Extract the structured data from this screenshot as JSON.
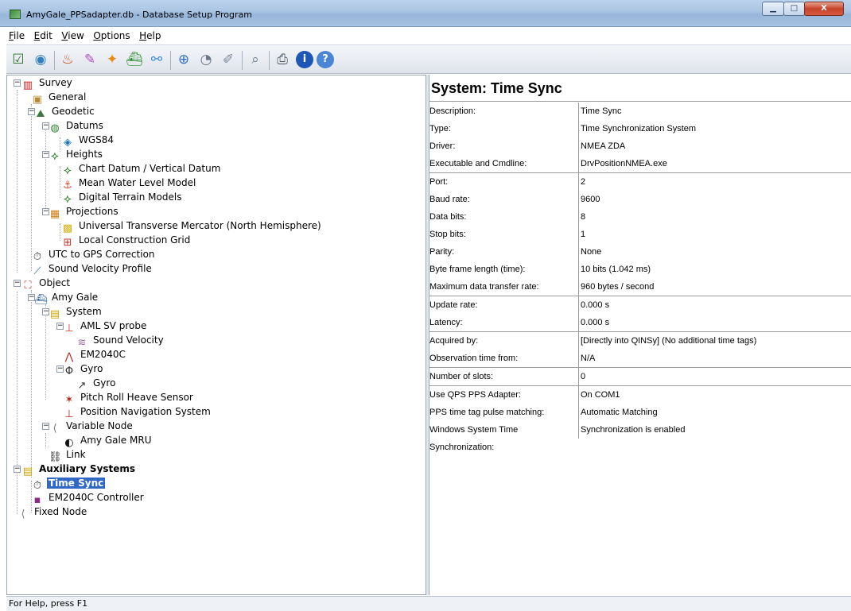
{
  "window": {
    "title": "AmyGale_PPSadapter.db - Database Setup Program",
    "controls": {
      "minimize": "▁",
      "maximize": "□",
      "close": "X"
    }
  },
  "menu": [
    "File",
    "Edit",
    "View",
    "Options",
    "Help"
  ],
  "toolbar": {
    "icons": [
      "new-database-icon",
      "globe-icon",
      "object-icon",
      "wand-icon",
      "add-node-icon",
      "vessel-icon",
      "link-icon",
      "web-icon",
      "pie-icon",
      "pen-icon",
      "preview-icon",
      "print-icon",
      "info-icon",
      "help-icon"
    ]
  },
  "tree": [
    {
      "label": "Survey",
      "icon": "survey-icon"
    },
    {
      "label": "General",
      "icon": "general-icon"
    },
    {
      "label": "Geodetic",
      "icon": "geodetic-icon"
    },
    {
      "label": "Datums",
      "icon": "datum-icon"
    },
    {
      "label": "WGS84",
      "icon": "wgs84-icon"
    },
    {
      "label": "Heights",
      "icon": "heights-icon"
    },
    {
      "label": "Chart Datum / Vertical Datum",
      "icon": "heights-icon"
    },
    {
      "label": "Mean Water Level Model",
      "icon": "water-level-icon"
    },
    {
      "label": "Digital Terrain Models",
      "icon": "heights-icon"
    },
    {
      "label": "Projections",
      "icon": "projection-icon"
    },
    {
      "label": "Universal Transverse Mercator (North Hemisphere)",
      "icon": "utm-icon"
    },
    {
      "label": "Local Construction Grid",
      "icon": "grid-icon"
    },
    {
      "label": "UTC to GPS Correction",
      "icon": "clock-icon"
    },
    {
      "label": "Sound Velocity Profile",
      "icon": "profile-icon"
    },
    {
      "label": "Object",
      "icon": "object-icon"
    },
    {
      "label": "Amy Gale",
      "icon": "vessel-icon"
    },
    {
      "label": "System",
      "icon": "system-icon"
    },
    {
      "label": "AML SV probe",
      "icon": "probe-icon"
    },
    {
      "label": "Sound Velocity",
      "icon": "sound-velocity-icon"
    },
    {
      "label": "EM2040C",
      "icon": "multibeam-icon"
    },
    {
      "label": "Gyro",
      "icon": "gyro-icon"
    },
    {
      "label": "Gyro",
      "icon": "gyro-arrow-icon"
    },
    {
      "label": "Pitch Roll Heave Sensor",
      "icon": "motion-sensor-icon"
    },
    {
      "label": "Position Navigation System",
      "icon": "antenna-icon"
    },
    {
      "label": "Variable Node",
      "icon": "node-icon"
    },
    {
      "label": "Amy Gale MRU",
      "icon": "mru-icon"
    },
    {
      "label": "Link",
      "icon": "link-icon"
    },
    {
      "label": "Auxiliary Systems",
      "icon": "system-icon"
    },
    {
      "label": "Time Sync",
      "icon": "clock-icon"
    },
    {
      "label": "EM2040C Controller",
      "icon": "controller-icon"
    },
    {
      "label": "Fixed Node",
      "icon": "node-icon"
    }
  ],
  "detail": {
    "title": "System: Time Sync",
    "rows": [
      {
        "k": "Description:",
        "v": "Time Sync"
      },
      {
        "k": "Type:",
        "v": "Time Synchronization System"
      },
      {
        "k": "Driver:",
        "v": "NMEA ZDA"
      },
      {
        "k": "Executable and Cmdline:",
        "v": "DrvPositionNMEA.exe"
      },
      {
        "k": "Port:",
        "v": "2"
      },
      {
        "k": "Baud rate:",
        "v": "9600"
      },
      {
        "k": "Data bits:",
        "v": "8"
      },
      {
        "k": "Stop bits:",
        "v": "1"
      },
      {
        "k": "Parity:",
        "v": "None"
      },
      {
        "k": "Byte frame length (time):",
        "v": "10 bits (1.042 ms)"
      },
      {
        "k": "Maximum data transfer rate:",
        "v": "960 bytes / second"
      },
      {
        "k": "Update rate:",
        "v": "0.000 s"
      },
      {
        "k": "Latency:",
        "v": "0.000 s"
      },
      {
        "k": "Acquired by:",
        "v": "[Directly into QINSy] (No additional time tags)"
      },
      {
        "k": "Observation time from:",
        "v": "N/A"
      },
      {
        "k": "Number of slots:",
        "v": "0"
      },
      {
        "k": "Use QPS PPS Adapter:",
        "v": "On COM1"
      },
      {
        "k": "PPS time tag pulse matching:",
        "v": "Automatic Matching"
      },
      {
        "k": "Windows System Time Synchronization:",
        "v": "Synchronization is enabled"
      }
    ]
  },
  "status": {
    "text": "For Help, press F1"
  }
}
